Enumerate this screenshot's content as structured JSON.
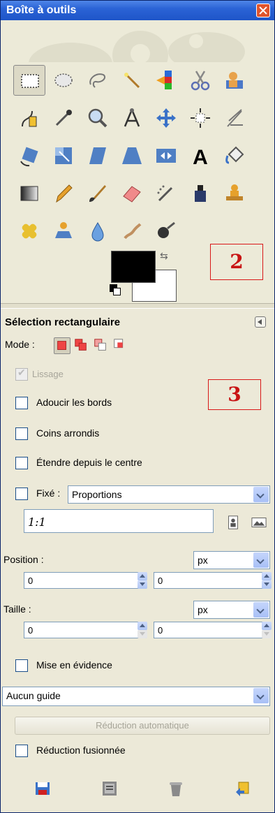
{
  "window": {
    "title": "Boîte à outils"
  },
  "tools": {
    "row1": [
      "rectangle-select-icon",
      "ellipse-select-icon",
      "lasso-select-icon",
      "fuzzy-select-icon",
      "color-select-icon",
      "scissors-select-icon",
      "foreground-select-icon"
    ],
    "row2": [
      "paths-icon",
      "color-picker-icon",
      "zoom-icon",
      "measure-icon",
      "move-icon",
      "align-icon",
      "crop-icon"
    ],
    "row3": [
      "rotate-icon",
      "scale-icon",
      "shear-icon",
      "perspective-icon",
      "flip-icon",
      "text-icon",
      "bucket-fill-icon"
    ],
    "row4": [
      "blend-icon",
      "pencil-icon",
      "paintbrush-icon",
      "eraser-icon",
      "airbrush-icon",
      "ink-icon",
      "clone-icon"
    ],
    "row5": [
      "heal-icon",
      "perspective-clone-icon",
      "blur-sharpen-icon",
      "smudge-icon",
      "dodge-burn-icon"
    ]
  },
  "colors": {
    "foreground": "#000000",
    "background": "#ffffff"
  },
  "annotations": {
    "label_2": "2",
    "label_3": "3"
  },
  "options": {
    "title": "Sélection rectangulaire",
    "mode_label": "Mode :",
    "antialias_label": "Lissage",
    "feather_label": "Adoucir les bords",
    "rounded_label": "Coins arrondis",
    "expand_label": "Étendre depuis le centre",
    "fixed_label": "Fixé :",
    "fixed_value": "Proportions",
    "ratio_value": "1:1",
    "position_label": "Position :",
    "position_unit": "px",
    "position_x": "0",
    "position_y": "0",
    "size_label": "Taille :",
    "size_unit": "px",
    "size_w": "0",
    "size_h": "0",
    "highlight_label": "Mise en évidence",
    "guide_value": "Aucun guide",
    "auto_shrink_label": "Réduction automatique",
    "shrink_merged_label": "Réduction fusionnée"
  }
}
